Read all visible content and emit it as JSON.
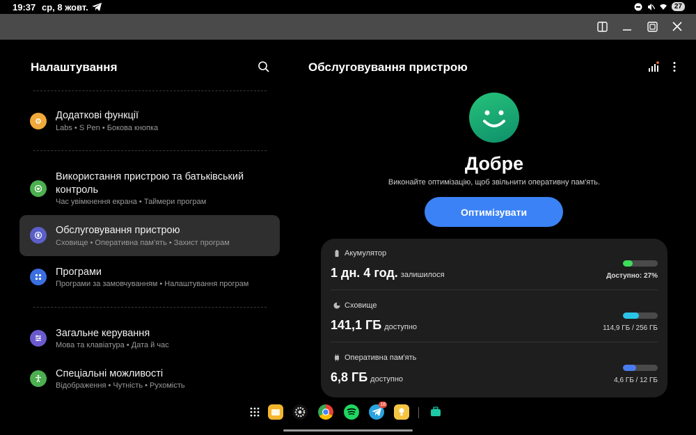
{
  "status_bar": {
    "time": "19:37",
    "date": "ср, 8 жовт.",
    "battery": "27"
  },
  "left": {
    "title": "Налаштування",
    "items": [
      {
        "title": "Додаткові функції",
        "subtitle": "Labs • S Pen • Бокова кнопка",
        "icon": "star-gear-icon",
        "color": "#f0a93b"
      },
      {
        "title": "Використання пристрою та батьківський контроль",
        "subtitle": "Час увімкнення екрана • Таймери програм",
        "icon": "heart-circle-icon",
        "color": "#4caf50"
      },
      {
        "title": "Обслуговування пристрою",
        "subtitle": "Сховище • Оперативна пам'ять • Захист програм",
        "icon": "device-care-icon",
        "color": "#5b5fc7"
      },
      {
        "title": "Програми",
        "subtitle": "Програми за замовчуванням • Налаштування програм",
        "icon": "apps-grid-icon",
        "color": "#3b6fe0"
      },
      {
        "title": "Загальне керування",
        "subtitle": "Мова та клавіатура • Дата й час",
        "icon": "sliders-icon",
        "color": "#6a5acd"
      },
      {
        "title": "Спеціальні можливості",
        "subtitle": "Відображення • Чутність • Рухомість",
        "icon": "accessibility-icon",
        "color": "#4caf50"
      }
    ]
  },
  "right": {
    "title": "Обслуговування пристрою",
    "status_word": "Добре",
    "status_desc": "Виконайте оптимізацію, щоб звільнити оперативну пам'ять.",
    "optimize_label": "Оптимізувати",
    "metrics": [
      {
        "label": "Акумулятор",
        "value": "1 дн. 4 год.",
        "unit": "залишилося",
        "right_text": "Доступно: 27%",
        "fill": 0.27,
        "color": "#3ddc5a"
      },
      {
        "label": "Сховище",
        "value": "141,1 ГБ",
        "unit": "доступно",
        "right_text": "114,9 ГБ / 256 ГБ",
        "fill": 0.45,
        "color": "#2bc4e8"
      },
      {
        "label": "Оперативна пам'ять",
        "value": "6,8 ГБ",
        "unit": "доступно",
        "right_text": "4,6 ГБ / 12 ГБ",
        "fill": 0.38,
        "color": "#4a7cf0"
      }
    ]
  },
  "dock": {
    "telegram_badge": "18"
  }
}
